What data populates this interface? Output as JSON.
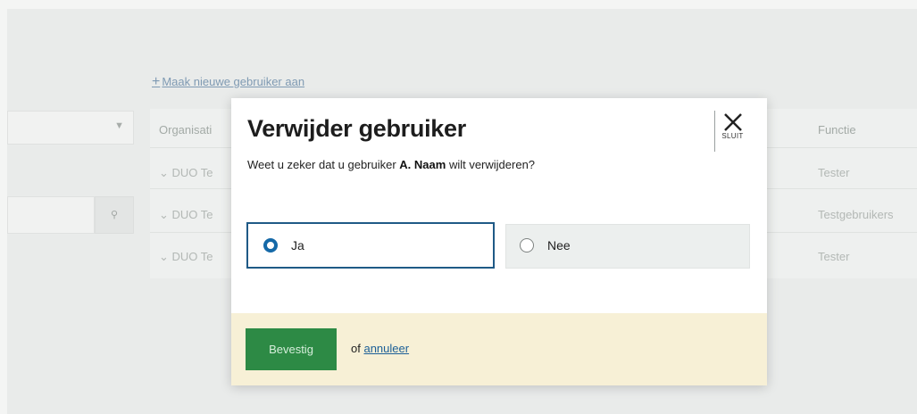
{
  "background": {
    "create_link_icon": "plus-icon",
    "create_link": "Maak nieuwe gebruiker aan",
    "select_chevron_icon": "chevron-down-icon",
    "search_icon": "search-icon",
    "columns": {
      "organisation": "Organisati",
      "function": "Functie"
    },
    "rows": [
      {
        "organisation": "DUO Te",
        "function": "Tester"
      },
      {
        "organisation": "DUO Te",
        "function": "Testgebruikers"
      },
      {
        "organisation": "DUO Te",
        "function": "Tester"
      }
    ]
  },
  "modal": {
    "title": "Verwijder gebruiker",
    "close_icon": "close-icon",
    "close_label": "SLUIT",
    "question_before": "Weet u zeker dat u gebruiker ",
    "question_name": "A. Naam",
    "question_after": " wilt verwijderen?",
    "options": [
      {
        "label": "Ja",
        "selected": true
      },
      {
        "label": "Nee",
        "selected": false
      }
    ],
    "confirm_label": "Bevestig",
    "or_text": "of",
    "cancel_label": "annuleer"
  },
  "colors": {
    "primary_button": "#2d8a45",
    "selected_radio": "#1569a8",
    "footer_background": "#f7f0d6",
    "link": "#1c5f97"
  }
}
